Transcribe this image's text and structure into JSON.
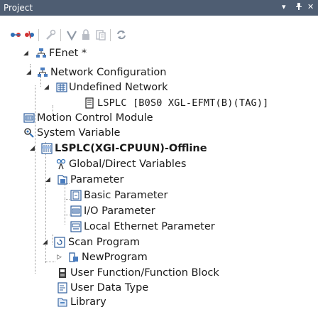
{
  "panel": {
    "title": "Project",
    "pin_glyph": "▾",
    "autohide_glyph": "↕",
    "close_glyph": "✕"
  },
  "toolbar": {
    "items": [
      {
        "name": "connect-icon",
        "enabled": true
      },
      {
        "name": "disconnect-icon",
        "enabled": true
      },
      {
        "name": "wrench-icon",
        "enabled": false
      },
      {
        "name": "check-icon",
        "enabled": false
      },
      {
        "name": "lock-icon",
        "enabled": false
      },
      {
        "name": "compare-icon",
        "enabled": false
      },
      {
        "name": "refresh-icon",
        "enabled": false
      }
    ]
  },
  "tree": {
    "root": {
      "label": "FEnet *",
      "icon": "network-tree-icon",
      "expanded": true
    },
    "network_configuration": {
      "label": "Network Configuration",
      "icon": "network-tree-icon",
      "expanded": true
    },
    "undefined_network": {
      "label": "Undefined Network",
      "icon": "network-block-icon",
      "expanded": true
    },
    "lsplc_module": {
      "label": "LSPLC [B0S0 XGL-EFMT(B)(TAG)]",
      "icon": "ethernet-module-icon"
    },
    "motion_control": {
      "label": "Motion Control Module",
      "icon": "module-icon"
    },
    "system_variable": {
      "label": "System Variable",
      "icon": "system-variable-icon"
    },
    "plc": {
      "label": "LSPLC(XGI-CPUUN)-Offline",
      "icon": "plc-icon",
      "expanded": true
    },
    "global_variables": {
      "label": "Global/Direct Variables",
      "icon": "global-variable-icon"
    },
    "parameter": {
      "label": "Parameter",
      "icon": "parameter-folder-icon",
      "expanded": true
    },
    "basic_parameter": {
      "label": "Basic Parameter",
      "icon": "basic-parameter-icon"
    },
    "io_parameter": {
      "label": "I/O Parameter",
      "icon": "io-parameter-icon"
    },
    "local_ethernet": {
      "label": "Local Ethernet Parameter",
      "icon": "ethernet-parameter-icon"
    },
    "scan_program": {
      "label": "Scan Program",
      "icon": "scan-program-icon",
      "expanded": true
    },
    "new_program": {
      "label": "NewProgram",
      "icon": "program-icon",
      "expanded": false
    },
    "user_function": {
      "label": "User Function/Function Block",
      "icon": "function-block-icon"
    },
    "user_data_type": {
      "label": "User Data Type",
      "icon": "data-type-icon"
    },
    "library": {
      "label": "Library",
      "icon": "library-icon"
    }
  },
  "colors": {
    "titlebar": "#4e5d72",
    "icon_blue": "#2f6fb7",
    "icon_red": "#d23232",
    "disabled": "#b8bcc4"
  }
}
